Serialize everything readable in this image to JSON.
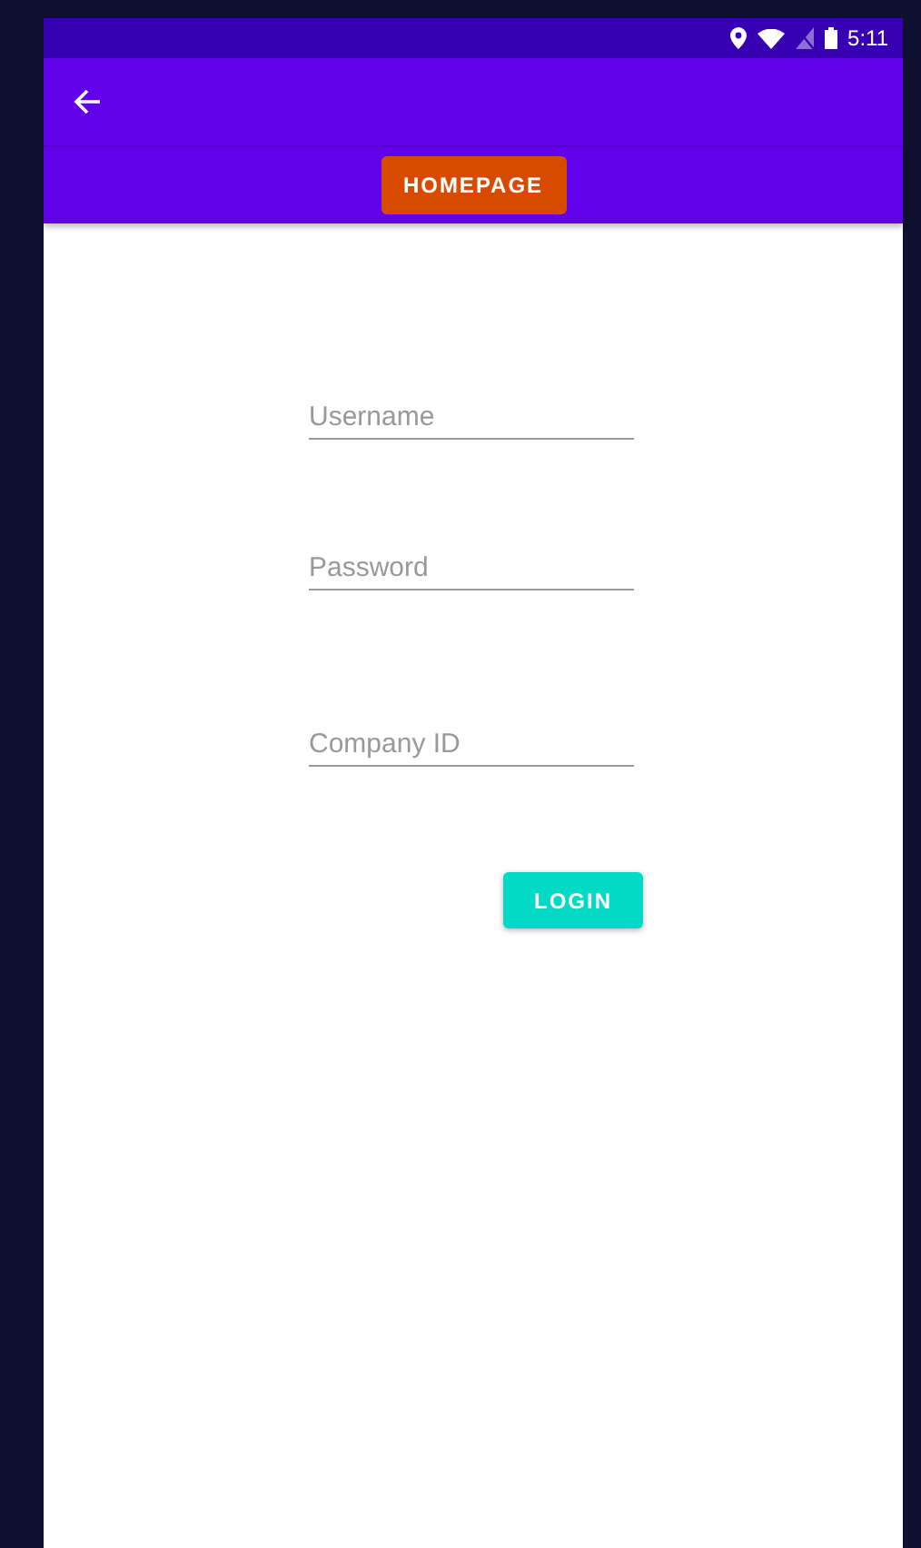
{
  "status_bar": {
    "time": "5:11"
  },
  "nav_button": {
    "label": "HOMEPAGE"
  },
  "fields": [
    {
      "placeholder": "Username"
    },
    {
      "placeholder": "Password"
    },
    {
      "placeholder": "Company ID"
    }
  ],
  "login_button": {
    "label": "LOGIN"
  }
}
